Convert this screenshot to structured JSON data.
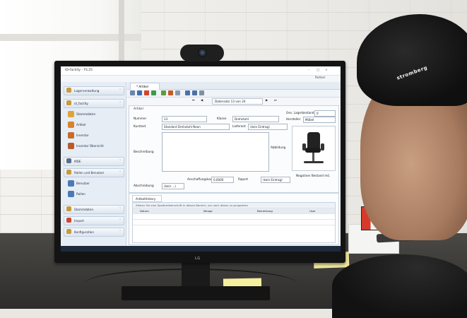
{
  "app": {
    "title": "ID-Facility - FS.25",
    "user": "Partner",
    "window_controls": [
      "–",
      "□",
      "×"
    ]
  },
  "sidebar": {
    "groups": [
      {
        "label": "Lagerverwaltung",
        "chev": "˅"
      },
      {
        "label": "id_facility",
        "chev": "˅"
      },
      {
        "label": "MDE",
        "chev": "˅"
      },
      {
        "label": "Rollen und Benutzer",
        "chev": "˅"
      },
      {
        "label": "Stammdaten",
        "chev": "˅"
      },
      {
        "label": "Import",
        "chev": "˅"
      },
      {
        "label": "Konfiguration",
        "chev": "˅"
      }
    ],
    "items": [
      {
        "label": "Stammdaten",
        "color": "#e0a33a"
      },
      {
        "label": "Artikel",
        "color": "#d9822b"
      },
      {
        "label": "Inventar",
        "color": "#c86b2a"
      },
      {
        "label": "Inventar Übersicht",
        "color": "#b85b2a"
      },
      {
        "label": "Benutzer",
        "color": "#4b79b5"
      },
      {
        "label": "Rollen",
        "color": "#4b79b5"
      }
    ]
  },
  "tab": {
    "label": "* Artikel"
  },
  "nav": {
    "record": "Datensatz 13 von 24",
    "first": "⏮",
    "prev": "◀",
    "next": "▶",
    "last": "⏭"
  },
  "form": {
    "group_title": "Artikel",
    "nummer_label": "Nummer",
    "nummer_value": "13",
    "klasse_label": "Klasse",
    "klasse_value": "Drehstuhl",
    "lagerbestand_label": "Ges. Lagerbestand",
    "lagerbestand_value": "0",
    "kurztext_label": "Kurztext",
    "kurztext_value": "Standard Drehstuhl Neon",
    "lieferant_label": "Lieferant",
    "lieferant_value": "(kein Eintrag)",
    "hersteller_label": "Hersteller",
    "hersteller_value": "Möbel",
    "beschreibung_label": "Beschreibung",
    "abbildung_label": "Abbildung",
    "abschreibung_label": "Abschreibung",
    "abschreibung_value": "(kein ...)",
    "anschaffung_label": "Anschaffungskosten",
    "anschaffung_value": "0,0000",
    "raport_label": "Raport",
    "raport_value": "(kein Eintrag)",
    "negativer_label": "Negativer Bestand mö."
  },
  "history": {
    "tab": "ArtikelHistory",
    "hint": "Ziehen Sie eine Spaltenüberschrift in diesen Bereich, um nach dieser zu gruppieren",
    "columns": [
      "Datum",
      "Menge",
      "Bemerkung",
      "User"
    ]
  },
  "monitor": {
    "brand": "LG"
  },
  "cap_text": "stromberg"
}
